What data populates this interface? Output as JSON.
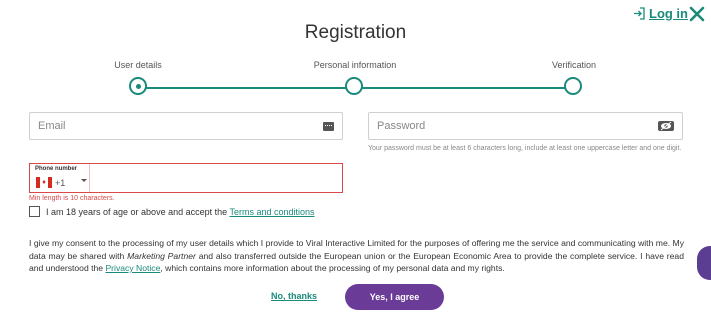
{
  "header": {
    "login_label": "Log in",
    "title": "Registration"
  },
  "steps": [
    {
      "label": "User details",
      "state": "active"
    },
    {
      "label": "Personal information",
      "state": "pending"
    },
    {
      "label": "Verification",
      "state": "pending"
    }
  ],
  "email": {
    "placeholder": "Email",
    "value": ""
  },
  "password": {
    "placeholder": "Password",
    "value": "",
    "hint": "Your password must be at least 6 characters long, include at least one uppercase letter and one digit."
  },
  "phone": {
    "label": "Phone number",
    "country_code": "+1",
    "value": "",
    "error": "Min length is 10 characters."
  },
  "age_check": {
    "text": "I am 18 years of age or above and accept the",
    "link": "Terms and conditions",
    "checked": false
  },
  "consent": {
    "part1": "I give my consent to the processing of my user details which I provide to Viral Interactive Limited for the purposes of offering me the service and communicating with me. My data may be shared with",
    "partner": "Marketing Partner",
    "part2": "and also transferred outside the European union or the European Economic Area to provide the complete service. I have read and understood the",
    "privacy_link": "Privacy Notice",
    "part3": ", which contains more information about the processing of my personal data and my rights."
  },
  "actions": {
    "decline_label": "No, thanks",
    "accept_label": "Yes, I agree"
  },
  "colors": {
    "accent": "#1a8a7a",
    "primary_button": "#6a3c97",
    "error": "#d84a4a"
  }
}
